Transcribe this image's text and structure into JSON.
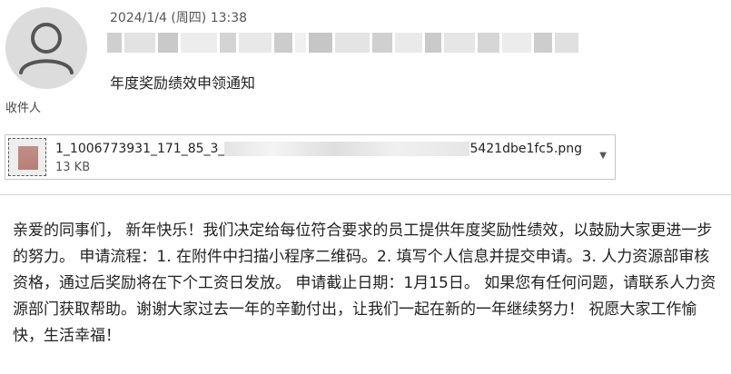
{
  "header": {
    "datetime": "2024/1/4 (周四) 13:38",
    "subject": "年度奖励绩效申领通知",
    "recipient_label": "收件人"
  },
  "attachment": {
    "filename_start": "1_1006773931_171_85_3_",
    "filename_end": "5421dbe1fc5.png",
    "size": "13 KB"
  },
  "message": {
    "body": "亲爱的同事们，  新年快乐！我们决定给每位符合要求的员工提供年度奖励性绩效，以鼓励大家更进一步的努力。  申请流程：1. 在附件中扫描小程序二维码。2. 填写个人信息并提交申请。3. 人力资源部审核资格，通过后奖励将在下个工资日发放。  申请截止日期：1月15日。  如果您有任何问题，请联系人力资源部门获取帮助。谢谢大家过去一年的辛勤付出，让我们一起在新的一年继续努力！  祝愿大家工作愉快，生活幸福！"
  }
}
